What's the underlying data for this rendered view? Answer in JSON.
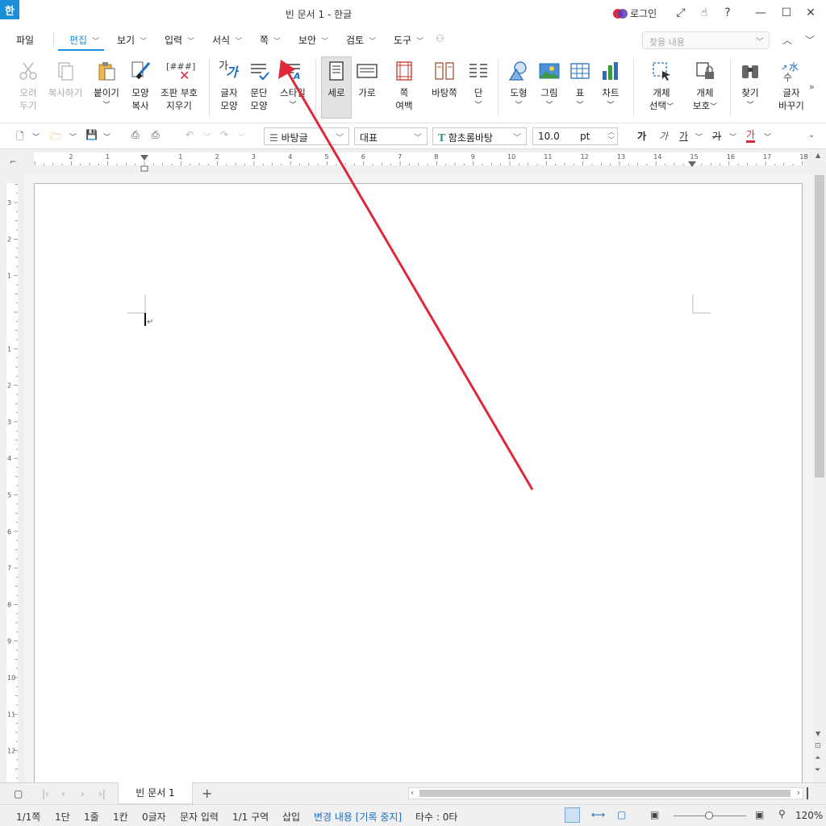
{
  "window": {
    "title": "빈 문서 1 - 한글",
    "app_icon_glyph": "한",
    "login_label": "로그인"
  },
  "menu": {
    "file": "파일",
    "items": [
      "편집",
      "보기",
      "입력",
      "서식",
      "쪽",
      "보안",
      "검토",
      "도구"
    ],
    "search_placeholder": "찾을 내용"
  },
  "ribbon": {
    "cut": [
      "오려",
      "두기"
    ],
    "copy": "복사하기",
    "paste": "붙이기",
    "format_copy": [
      "모양",
      "복사"
    ],
    "clear_marks": [
      "조판 부호",
      "지우기"
    ],
    "char_shape": [
      "글자",
      "모양"
    ],
    "para_shape": [
      "문단",
      "모양"
    ],
    "style": "스타일",
    "portrait": "세로",
    "landscape": "가로",
    "page_margin": [
      "쪽",
      "여백"
    ],
    "master_page": "바탕쪽",
    "columns": "단",
    "shape": "도형",
    "picture": "그림",
    "table": "표",
    "chart": "차트",
    "object_select": [
      "개체",
      "선택"
    ],
    "object_protect": [
      "개체",
      "보호"
    ],
    "find": "찾기",
    "replace": [
      "글자",
      "바꾸기"
    ],
    "clear_marks_icon_text": "[###]",
    "char_shape_icon_text": "가",
    "replace_icon_text": "水"
  },
  "toolbar": {
    "style_value": "바탕글",
    "lang_value": "대표",
    "font_value": "함초롬바탕",
    "font_icon": "T",
    "size_value": "10.0",
    "size_unit": "pt",
    "bold": "가",
    "italic": "가",
    "underline": "가",
    "strike": "가",
    "color": "가"
  },
  "ruler": {
    "h_labels": [
      "2",
      "1",
      "1",
      "2",
      "3",
      "4",
      "5",
      "6",
      "7",
      "8",
      "9",
      "10",
      "11",
      "12",
      "13",
      "14",
      "15",
      "16",
      "17",
      "18"
    ],
    "v_labels": [
      "3",
      "2",
      "1",
      "1",
      "2",
      "3",
      "4",
      "5",
      "6",
      "7",
      "8",
      "9",
      "10",
      "11",
      "12"
    ]
  },
  "tabs": {
    "doc_tab": "빈 문서 1",
    "add": "+"
  },
  "status": {
    "page": "1/1쪽",
    "column": "1단",
    "line": "1줄",
    "col": "1칸",
    "chars": "0글자",
    "input_mode": "문자 입력",
    "section": "1/1 구역",
    "insert": "삽입",
    "track": "변경 내용 [기록 중지]",
    "typing": "타수 : 0타",
    "zoom": "120%"
  },
  "colors": {
    "accent": "#1b8fd8",
    "arrow": "#e0283a",
    "status_link": "#1b6fc2"
  }
}
